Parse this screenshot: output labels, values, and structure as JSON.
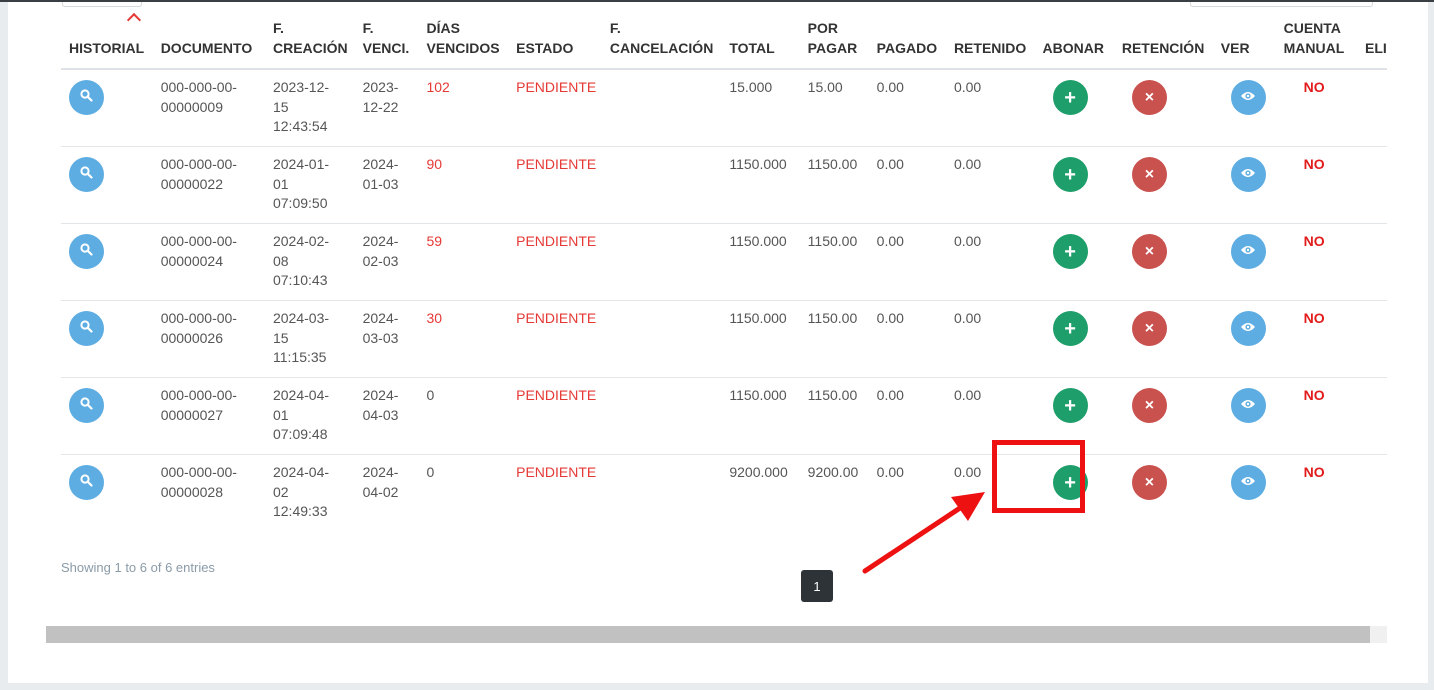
{
  "table": {
    "headers": [
      {
        "l1": "",
        "l2": "HISTORIAL"
      },
      {
        "l1": "",
        "l2": "DOCUMENTO"
      },
      {
        "l1": "F.",
        "l2": "CREACIÓN"
      },
      {
        "l1": "F.",
        "l2": "VENCI."
      },
      {
        "l1": "DÍAS",
        "l2": "VENCIDOS"
      },
      {
        "l1": "",
        "l2": "ESTADO"
      },
      {
        "l1": "F.",
        "l2": "CANCELACIÓN"
      },
      {
        "l1": "",
        "l2": "TOTAL"
      },
      {
        "l1": "POR",
        "l2": "PAGAR"
      },
      {
        "l1": "",
        "l2": "PAGADO"
      },
      {
        "l1": "",
        "l2": "RETENIDO"
      },
      {
        "l1": "",
        "l2": "ABONAR"
      },
      {
        "l1": "",
        "l2": "RETENCIÓN"
      },
      {
        "l1": "",
        "l2": "VER"
      },
      {
        "l1": "CUENTA",
        "l2": "MANUAL"
      },
      {
        "l1": "",
        "l2": "ELIMINAR"
      }
    ],
    "rows": [
      {
        "doc1": "000-000-00-",
        "doc2": "00000009",
        "c1": "2023-12-",
        "c2": "15",
        "c3": "12:43:54",
        "v1": "2023-",
        "v2": "12-22",
        "dias": "102",
        "estado": "PENDIENTE",
        "cancel": "",
        "total": "15.000",
        "porpagar": "15.00",
        "pagado": "0.00",
        "retenido": "0.00",
        "manual": "NO"
      },
      {
        "doc1": "000-000-00-",
        "doc2": "00000022",
        "c1": "2024-01-",
        "c2": "01",
        "c3": "07:09:50",
        "v1": "2024-",
        "v2": "01-03",
        "dias": "90",
        "estado": "PENDIENTE",
        "cancel": "",
        "total": "1150.000",
        "porpagar": "1150.00",
        "pagado": "0.00",
        "retenido": "0.00",
        "manual": "NO"
      },
      {
        "doc1": "000-000-00-",
        "doc2": "00000024",
        "c1": "2024-02-",
        "c2": "08",
        "c3": "07:10:43",
        "v1": "2024-",
        "v2": "02-03",
        "dias": "59",
        "estado": "PENDIENTE",
        "cancel": "",
        "total": "1150.000",
        "porpagar": "1150.00",
        "pagado": "0.00",
        "retenido": "0.00",
        "manual": "NO"
      },
      {
        "doc1": "000-000-00-",
        "doc2": "00000026",
        "c1": "2024-03-",
        "c2": "15",
        "c3": "11:15:35",
        "v1": "2024-",
        "v2": "03-03",
        "dias": "30",
        "estado": "PENDIENTE",
        "cancel": "",
        "total": "1150.000",
        "porpagar": "1150.00",
        "pagado": "0.00",
        "retenido": "0.00",
        "manual": "NO"
      },
      {
        "doc1": "000-000-00-",
        "doc2": "00000027",
        "c1": "2024-04-",
        "c2": "01",
        "c3": "07:09:48",
        "v1": "2024-",
        "v2": "04-03",
        "dias": "0",
        "estado": "PENDIENTE",
        "cancel": "",
        "total": "1150.000",
        "porpagar": "1150.00",
        "pagado": "0.00",
        "retenido": "0.00",
        "manual": "NO"
      },
      {
        "doc1": "000-000-00-",
        "doc2": "00000028",
        "c1": "2024-04-",
        "c2": "02",
        "c3": "12:49:33",
        "v1": "2024-",
        "v2": "04-02",
        "dias": "0",
        "estado": "PENDIENTE",
        "cancel": "",
        "total": "9200.000",
        "porpagar": "9200.00",
        "pagado": "0.00",
        "retenido": "0.00",
        "manual": "NO"
      }
    ]
  },
  "footer": {
    "info": "Showing 1 to 6 of 6 entries",
    "page": "1"
  },
  "icons": {
    "historial": "search-icon",
    "abonar": "plus-icon",
    "retencion": "close-icon",
    "ver": "eye-icon",
    "sort": "sort-ascending-icon"
  },
  "colors": {
    "accent_blue": "#5dade2",
    "abonar_green": "#1e9e6a",
    "retencion_red": "#c9524f",
    "overdue_red": "#e53935",
    "annotation_red": "#ee1111"
  }
}
